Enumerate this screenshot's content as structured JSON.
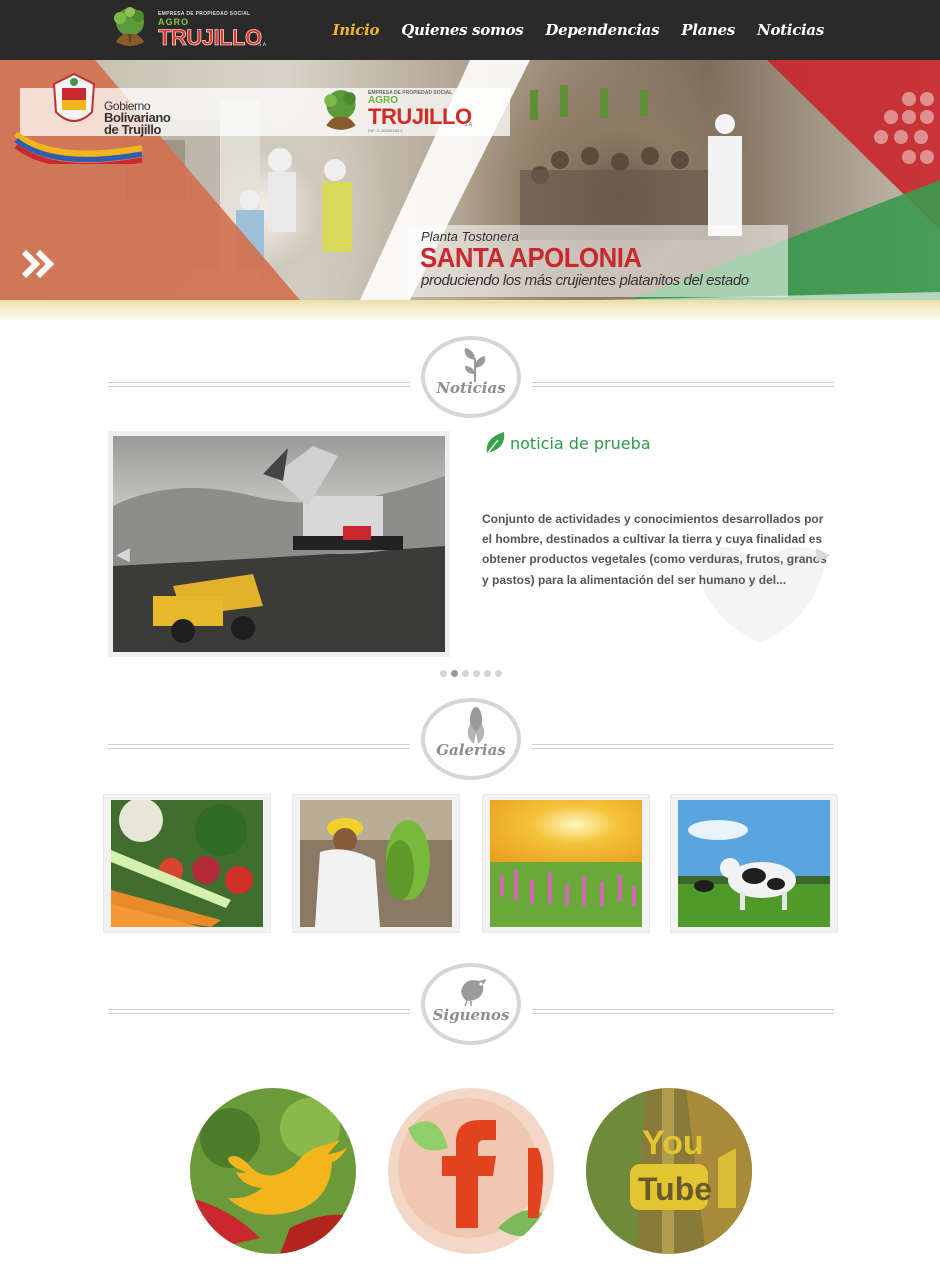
{
  "brand": {
    "company_small": "EMPRESA DE PROPIEDAD SOCIAL",
    "agro": "AGRO",
    "name": "TRUJILLO",
    "suffix": "S.A"
  },
  "nav": {
    "items": [
      {
        "label": "Inicio",
        "active": true
      },
      {
        "label": "Quienes somos",
        "active": false
      },
      {
        "label": "Dependencias",
        "active": false
      },
      {
        "label": "Planes",
        "active": false
      },
      {
        "label": "Noticias",
        "active": false
      }
    ],
    "active_color": "#f2b51c"
  },
  "hero": {
    "gov_line1": "Gobierno",
    "gov_line2": "Bolivariano",
    "gov_line3": "de Trujillo",
    "logo_small": "EMPRESA DE PROPIEDAD SOCIAL",
    "logo_agro": "AGRO",
    "logo_name": "TRUJILLO",
    "logo_suffix": "S.A",
    "logo_rif": "RIF: G-20009150-3",
    "caption_pre": "Planta Tostonera",
    "caption_title": "SANTA APOLONIA",
    "caption_sub": "produciendo los más crujientes platanitos del estado",
    "arrow_icon": "double-chevron-right-icon"
  },
  "sections": {
    "news": "Noticias",
    "gallery": "Galerias",
    "follow": "Siguenos"
  },
  "news": {
    "title": "noticia de prueba",
    "body": "Conjunto de actividades y conocimientos desarrollados por el hombre, destinados a cultivar la tierra y cuya finalidad es obtener productos vegetales (como verduras, frutos, granos y pastos) para la alimentación del ser humano y del...",
    "pages": 6,
    "current_page": 2
  },
  "gallery": [
    {
      "name": "vegetables"
    },
    {
      "name": "banana-worker"
    },
    {
      "name": "flower-field"
    },
    {
      "name": "cows"
    }
  ],
  "social": [
    {
      "name": "twitter",
      "icon": "twitter-bird-icon"
    },
    {
      "name": "facebook",
      "icon": "facebook-f-icon"
    },
    {
      "name": "youtube",
      "icon": "youtube-icon"
    }
  ],
  "colors": {
    "nav_bg": "#2a2a2a",
    "accent_green": "#2d9a4a",
    "brand_red": "#d42a24",
    "hero_orange": "#d2714f",
    "hero_green": "#3a9a4e",
    "hero_red": "#c8282e"
  }
}
